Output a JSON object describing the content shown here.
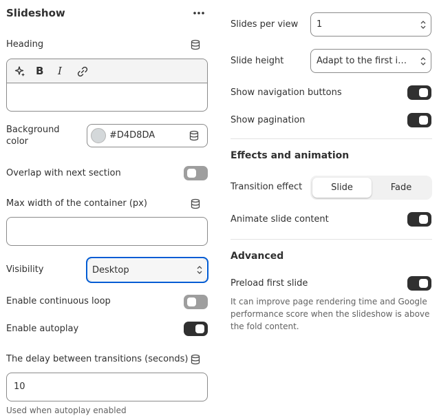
{
  "panel": {
    "title": "Slideshow",
    "menu_icon": "more-horizontal-icon"
  },
  "heading": {
    "label": "Heading",
    "toolbar": [
      "magic-icon",
      "bold-icon",
      "italic-icon",
      "link-icon"
    ],
    "value": ""
  },
  "background_color": {
    "label_line1": "Background",
    "label_line2": "color",
    "value": "#D4D8DA",
    "swatch": "#D4D8DA"
  },
  "overlap": {
    "label": "Overlap with next section",
    "on": false
  },
  "max_width": {
    "label": "Max width of the container (px)",
    "value": ""
  },
  "visibility": {
    "label": "Visibility",
    "value": "Desktop"
  },
  "continuous_loop": {
    "label": "Enable continuous loop",
    "on": false
  },
  "autoplay": {
    "label": "Enable autoplay",
    "on": true
  },
  "delay": {
    "label": "The delay between transitions (seconds)",
    "value": "10",
    "helper": "Used when autoplay enabled"
  },
  "slides_per_view": {
    "label": "Slides per view",
    "value": "1"
  },
  "slide_height": {
    "label": "Slide height",
    "value": "Adapt to the first image"
  },
  "nav_buttons": {
    "label": "Show navigation buttons",
    "on": true
  },
  "pagination": {
    "label": "Show pagination",
    "on": true
  },
  "effects": {
    "title": "Effects and animation",
    "transition_label": "Transition effect",
    "options": [
      "Slide",
      "Fade"
    ],
    "selected": "Slide",
    "animate_label": "Animate slide content",
    "animate_on": true
  },
  "advanced": {
    "title": "Advanced",
    "preload_label": "Preload first slide",
    "preload_on": true,
    "helper_line1": "It can improve page rendering time and Google",
    "helper_line2": "performance score when the slideshow is above",
    "helper_line3": "the fold content."
  },
  "colors": {
    "text": "#303030",
    "toggle_on": "#303030",
    "toggle_off": "#9E9E9E",
    "focus_ring": "#005BD3",
    "border": "#8A8A8A"
  }
}
